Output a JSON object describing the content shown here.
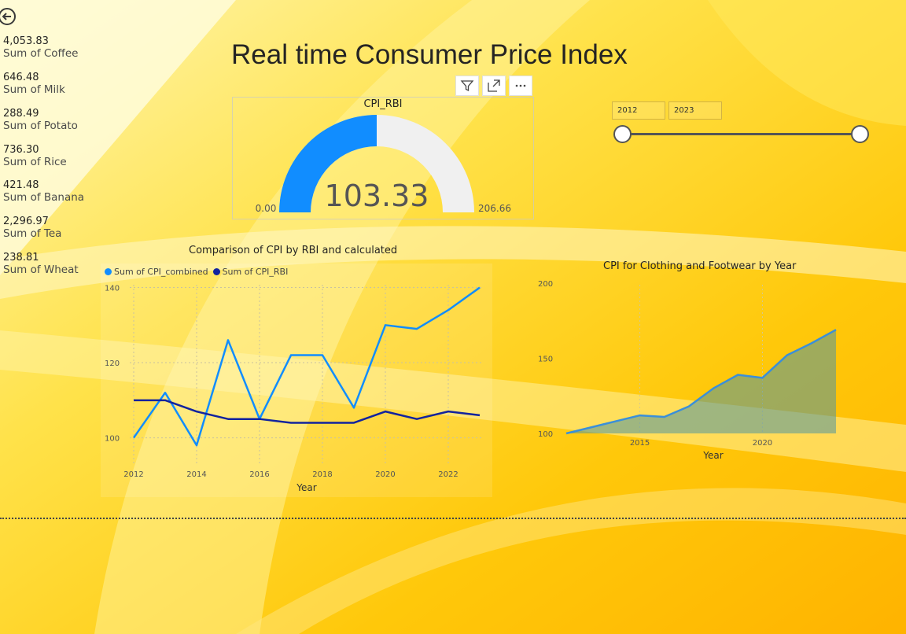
{
  "header": {
    "title": "Real time Consumer Price Index"
  },
  "cards": [
    {
      "value": "4,053.83",
      "label": "Sum of Coffee"
    },
    {
      "value": "646.48",
      "label": "Sum of Milk"
    },
    {
      "value": "288.49",
      "label": "Sum of Potato"
    },
    {
      "value": "736.30",
      "label": "Sum of Rice"
    },
    {
      "value": "421.48",
      "label": "Sum of Banana"
    },
    {
      "value": "2,296.97",
      "label": "Sum of Tea"
    },
    {
      "value": "238.81",
      "label": "Sum of Wheat"
    }
  ],
  "toolbar": {
    "icons": [
      "filter-icon",
      "focus-mode-icon",
      "more-options-icon"
    ]
  },
  "slicer": {
    "start": "2012",
    "end": "2023",
    "range": [
      2012,
      2023
    ]
  },
  "colors": {
    "accent": "#118DFF",
    "dark_series": "#12239E",
    "gauge_track": "#F0F0F0",
    "area_line": "#3A8FD9"
  },
  "gauge": {
    "title": "CPI_RBI",
    "value": "103.33",
    "min": "0.00",
    "max": "206.66",
    "fraction": 0.5
  },
  "chart_data": [
    {
      "type": "line",
      "title": "Comparison of CPI by RBI and calculated",
      "xlabel": "Year",
      "ylabel": "",
      "x": [
        2012,
        2013,
        2014,
        2015,
        2016,
        2017,
        2018,
        2019,
        2020,
        2021,
        2022,
        2023
      ],
      "x_ticks": [
        "2012",
        "2014",
        "2016",
        "2018",
        "2020",
        "2022"
      ],
      "y_ticks": [
        "100",
        "120",
        "140"
      ],
      "ylim": [
        93,
        142
      ],
      "grid": true,
      "legend": "top-left",
      "series": [
        {
          "name": "Sum of CPI_combined",
          "values": [
            100,
            112,
            98,
            126,
            105,
            122,
            122,
            108,
            130,
            129,
            134,
            140
          ]
        },
        {
          "name": "Sum of CPI_RBI",
          "values": [
            110,
            110,
            107,
            105,
            105,
            104,
            104,
            104,
            107,
            105,
            107,
            106
          ]
        }
      ]
    },
    {
      "type": "area",
      "title": "CPI for Clothing and Footwear by Year",
      "xlabel": "Year",
      "ylabel": "",
      "x": [
        2012,
        2013,
        2014,
        2015,
        2016,
        2017,
        2018,
        2019,
        2020,
        2021,
        2022,
        2023
      ],
      "x_ticks": [
        "2015",
        "2020"
      ],
      "y_ticks": [
        "100",
        "150",
        "200"
      ],
      "ylim": [
        100,
        200
      ],
      "grid": true,
      "values": [
        100,
        104,
        108,
        112,
        111,
        118,
        130,
        139,
        137,
        152,
        160,
        169
      ]
    }
  ]
}
